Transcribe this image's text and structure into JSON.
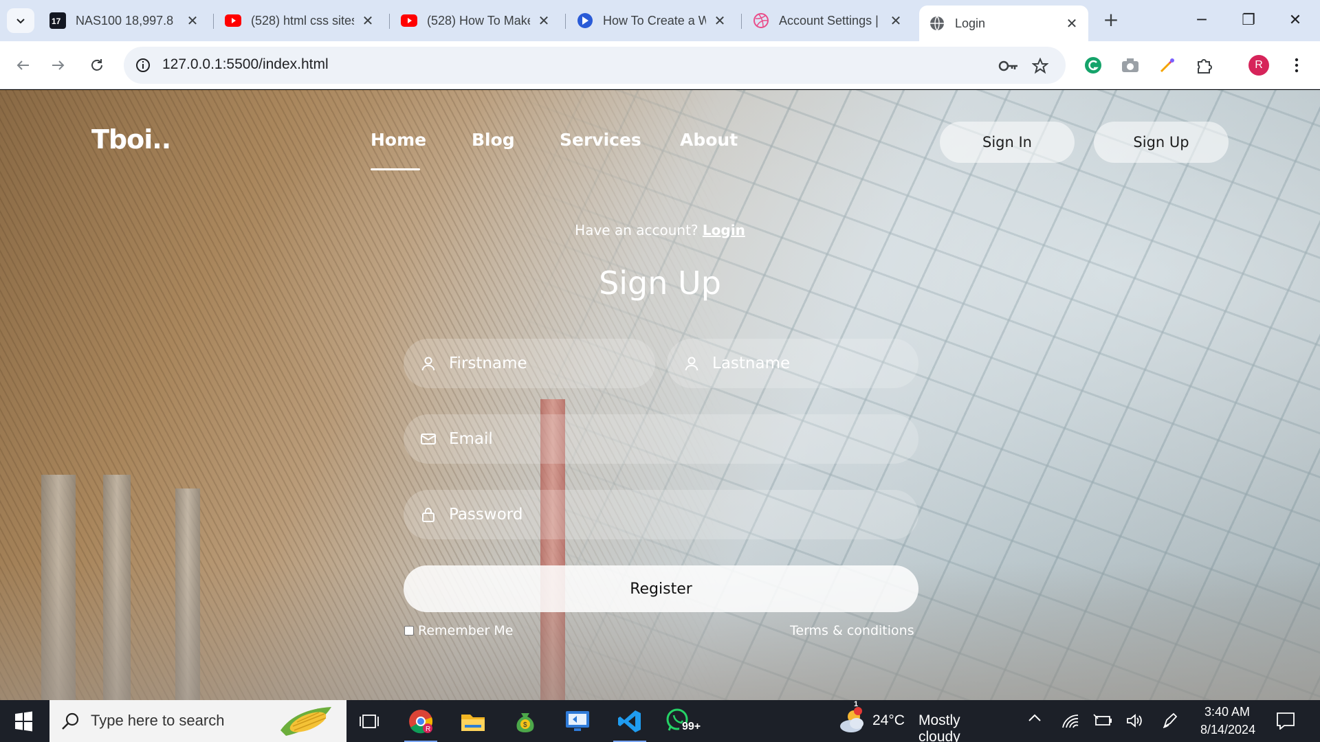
{
  "browser": {
    "tabs": [
      {
        "label": "NAS100 18,997.8 ▲",
        "icon": "tradingview-icon"
      },
      {
        "label": "(528) html css sites",
        "icon": "youtube-icon"
      },
      {
        "label": "(528) How To Make",
        "icon": "youtube-icon"
      },
      {
        "label": "How To Create a W",
        "icon": "bing-copilot-icon"
      },
      {
        "label": "Account Settings |",
        "icon": "dribbble-icon"
      },
      {
        "label": "Login",
        "icon": "globe-icon",
        "active": true
      }
    ],
    "url": "127.0.0.1:5500/index.html",
    "profile_initial": "R"
  },
  "site": {
    "brand": "Tboi..",
    "nav": {
      "home": "Home",
      "blog": "Blog",
      "services": "Services",
      "about": "About"
    },
    "sign_in": "Sign In",
    "sign_up": "Sign Up"
  },
  "form": {
    "have_account": "Have an account?",
    "login_link": "Login",
    "title": "Sign Up",
    "firstname_placeholder": "Firstname",
    "lastname_placeholder": "Lastname",
    "email_placeholder": "Email",
    "password_placeholder": "Password",
    "register": "Register",
    "remember": "Remember Me",
    "terms": "Terms & conditions"
  },
  "taskbar": {
    "search_placeholder": "Type here to search",
    "whatsapp_badge": "99+",
    "weather": {
      "temp": "24°C",
      "desc": "Mostly cloudy",
      "alert": "1"
    },
    "time": "3:40 AM",
    "date": "8/14/2024"
  }
}
